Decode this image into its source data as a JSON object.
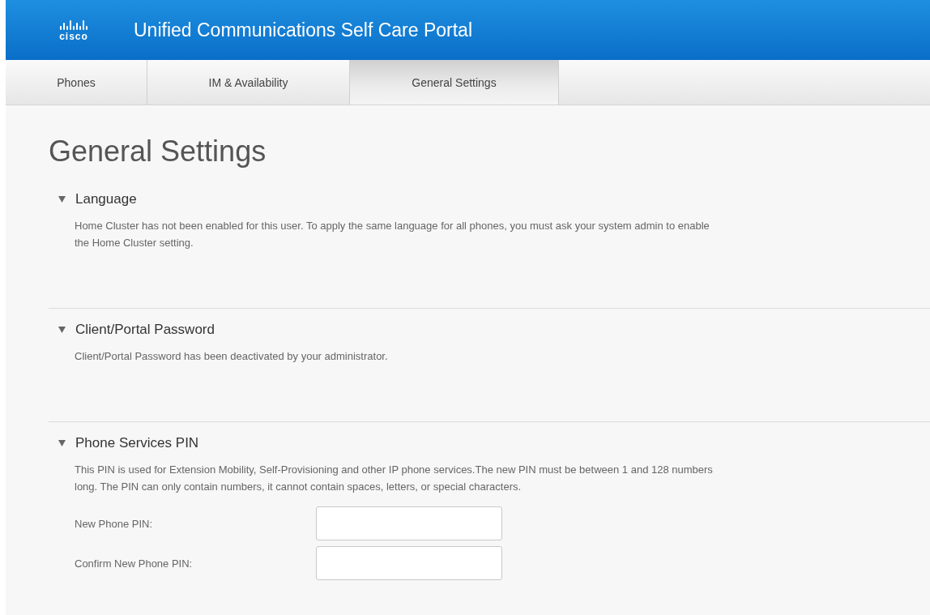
{
  "header": {
    "logo_text": "cisco",
    "title": "Unified Communications Self Care Portal"
  },
  "tabs": [
    {
      "label": "Phones",
      "selected": false
    },
    {
      "label": "IM & Availability",
      "selected": false
    },
    {
      "label": "General Settings",
      "selected": true
    }
  ],
  "page_title": "General Settings",
  "sections": [
    {
      "title": "Language",
      "expanded": true,
      "description": "Home Cluster has not been enabled for this user. To apply the same language for all phones, you must ask your system admin to enable the Home Cluster setting."
    },
    {
      "title": "Client/Portal Password",
      "expanded": true,
      "description": "Client/Portal Password has been deactivated by your administrator."
    },
    {
      "title": "Phone Services PIN",
      "expanded": true,
      "description": "This PIN is used for Extension Mobility, Self-Provisioning and other IP phone services.The new PIN must be between 1 and 128 numbers long. The PIN can only contain numbers, it cannot contain spaces, letters, or special characters.",
      "fields": [
        {
          "label": "New Phone PIN:"
        },
        {
          "label": "Confirm New Phone PIN:"
        }
      ]
    }
  ]
}
